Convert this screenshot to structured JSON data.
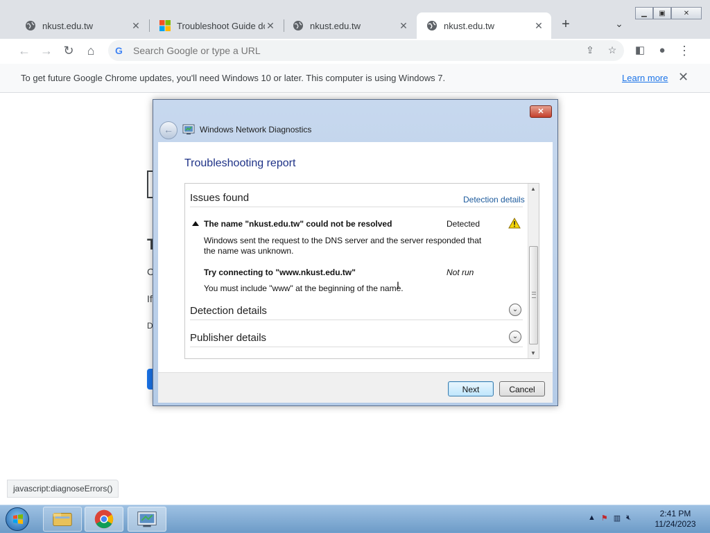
{
  "browser": {
    "tabs": [
      {
        "title": "nkust.edu.tw",
        "favicon": "globe-icon",
        "active": false
      },
      {
        "title": "Troubleshoot Guide dow",
        "favicon": "microsoft-icon",
        "active": false
      },
      {
        "title": "nkust.edu.tw",
        "favicon": "globe-icon",
        "active": false
      },
      {
        "title": "nkust.edu.tw",
        "favicon": "globe-icon",
        "active": true
      }
    ],
    "omnibox_placeholder": "Search Google or type a URL",
    "infobar": {
      "message": "To get future Google Chrome updates, you'll need Windows 10 or later. This computer is using Windows 7.",
      "link": "Learn more"
    },
    "status_url": "javascript:diagnoseErrors()"
  },
  "page_fragments": [
    "T",
    "C",
    "If",
    "D"
  ],
  "dialog": {
    "title": "Windows Network Diagnostics",
    "report_title": "Troubleshooting report",
    "issues_heading": "Issues found",
    "detection_link": "Detection details",
    "issues": [
      {
        "title": "The name \"nkust.edu.tw\" could not be resolved",
        "status": "Detected",
        "description": "Windows sent the request to the DNS server and the server responded that the name was unknown."
      },
      {
        "title": "Try connecting to \"www.nkust.edu.tw\"",
        "status": "Not run",
        "description": "You must include \"www\" at the beginning of the name."
      }
    ],
    "sections": [
      "Detection details",
      "Publisher details"
    ],
    "buttons": {
      "next": "Next",
      "cancel": "Cancel"
    }
  },
  "taskbar": {
    "clock_time": "2:41 PM",
    "clock_date": "11/24/2023",
    "items": [
      "explorer-icon",
      "chrome-icon",
      "network-diagnostics-icon"
    ]
  },
  "colors": {
    "link_blue": "#1a73e8",
    "dialog_heading": "#1e3287",
    "warning_yellow": "#f5d60a"
  }
}
